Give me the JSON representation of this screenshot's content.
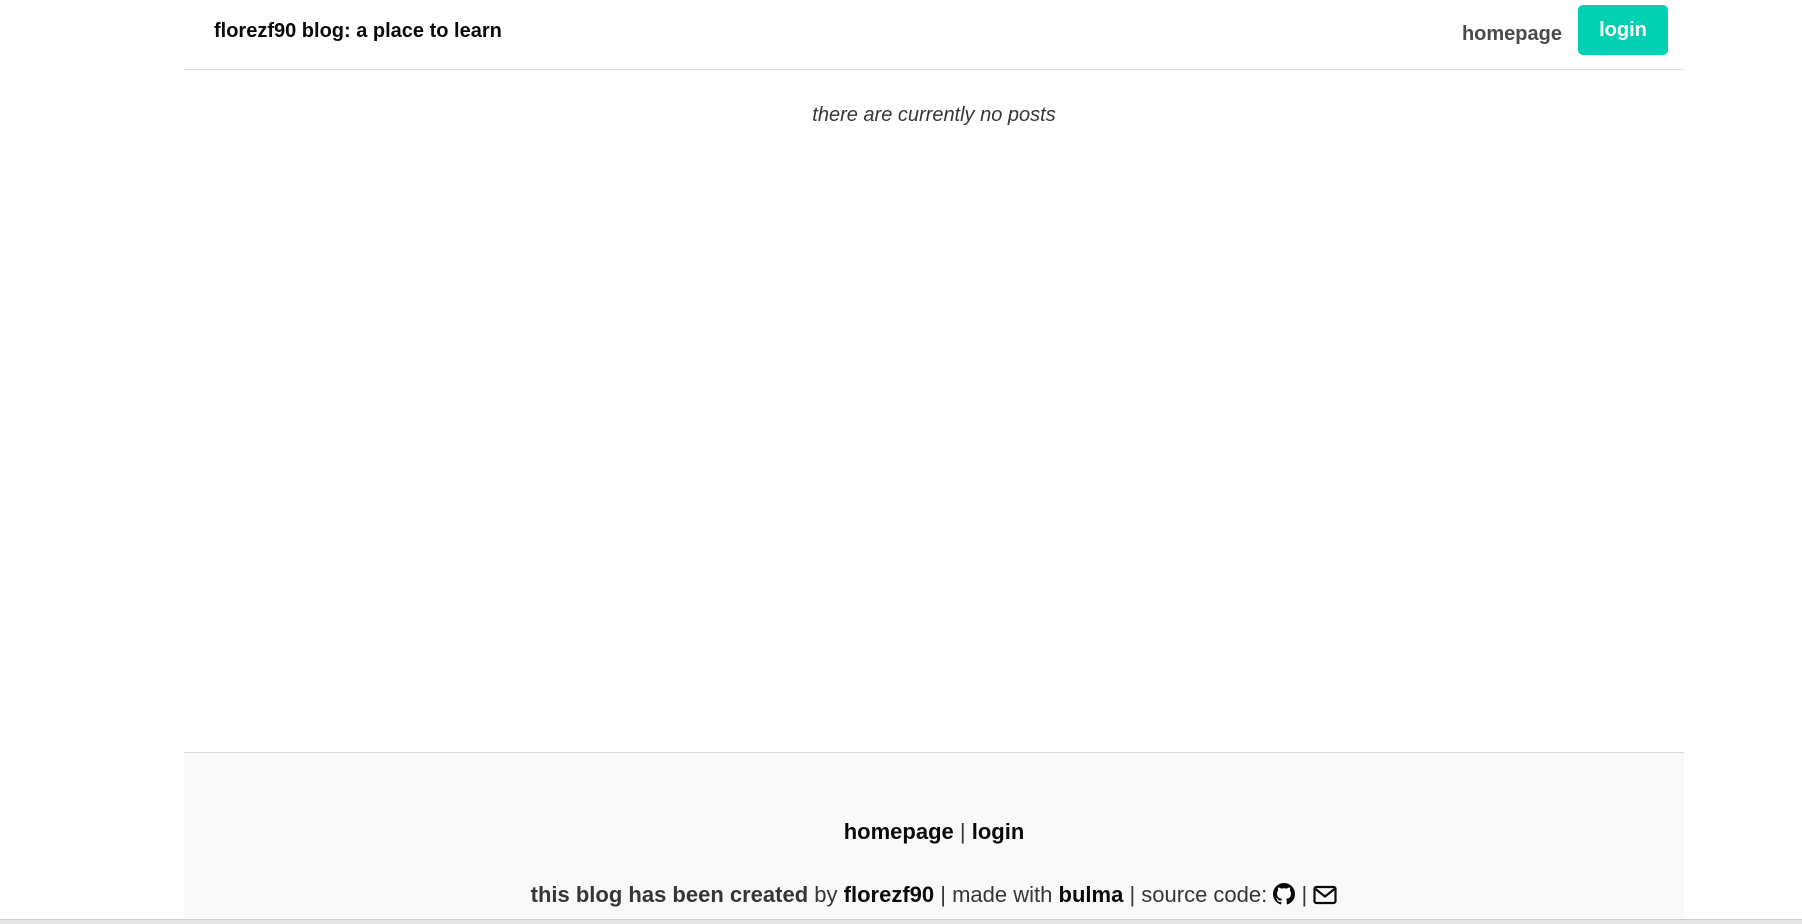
{
  "navbar": {
    "brand": "florezf90 blog: a place to learn",
    "homepage_label": "homepage",
    "login_label": "login"
  },
  "main": {
    "empty_message": "there are currently no posts"
  },
  "footer": {
    "links": {
      "homepage_label": "homepage",
      "separator": "|",
      "login_label": "login"
    },
    "credit": {
      "created_text": "this blog has been created",
      "by_text": "by",
      "author": "florezf90",
      "sep1": "|",
      "made_with_text": "made with",
      "framework": "bulma",
      "sep2": "|",
      "source_code_text": "source code:",
      "sep3": "|",
      "github_icon": "github-icon",
      "email_icon": "envelope-icon"
    }
  },
  "colors": {
    "accent": "#00d1b2",
    "text": "#363636",
    "link": "#0a0a0a",
    "footer_bg": "#f9f9f9",
    "border": "#dbdbdb"
  }
}
